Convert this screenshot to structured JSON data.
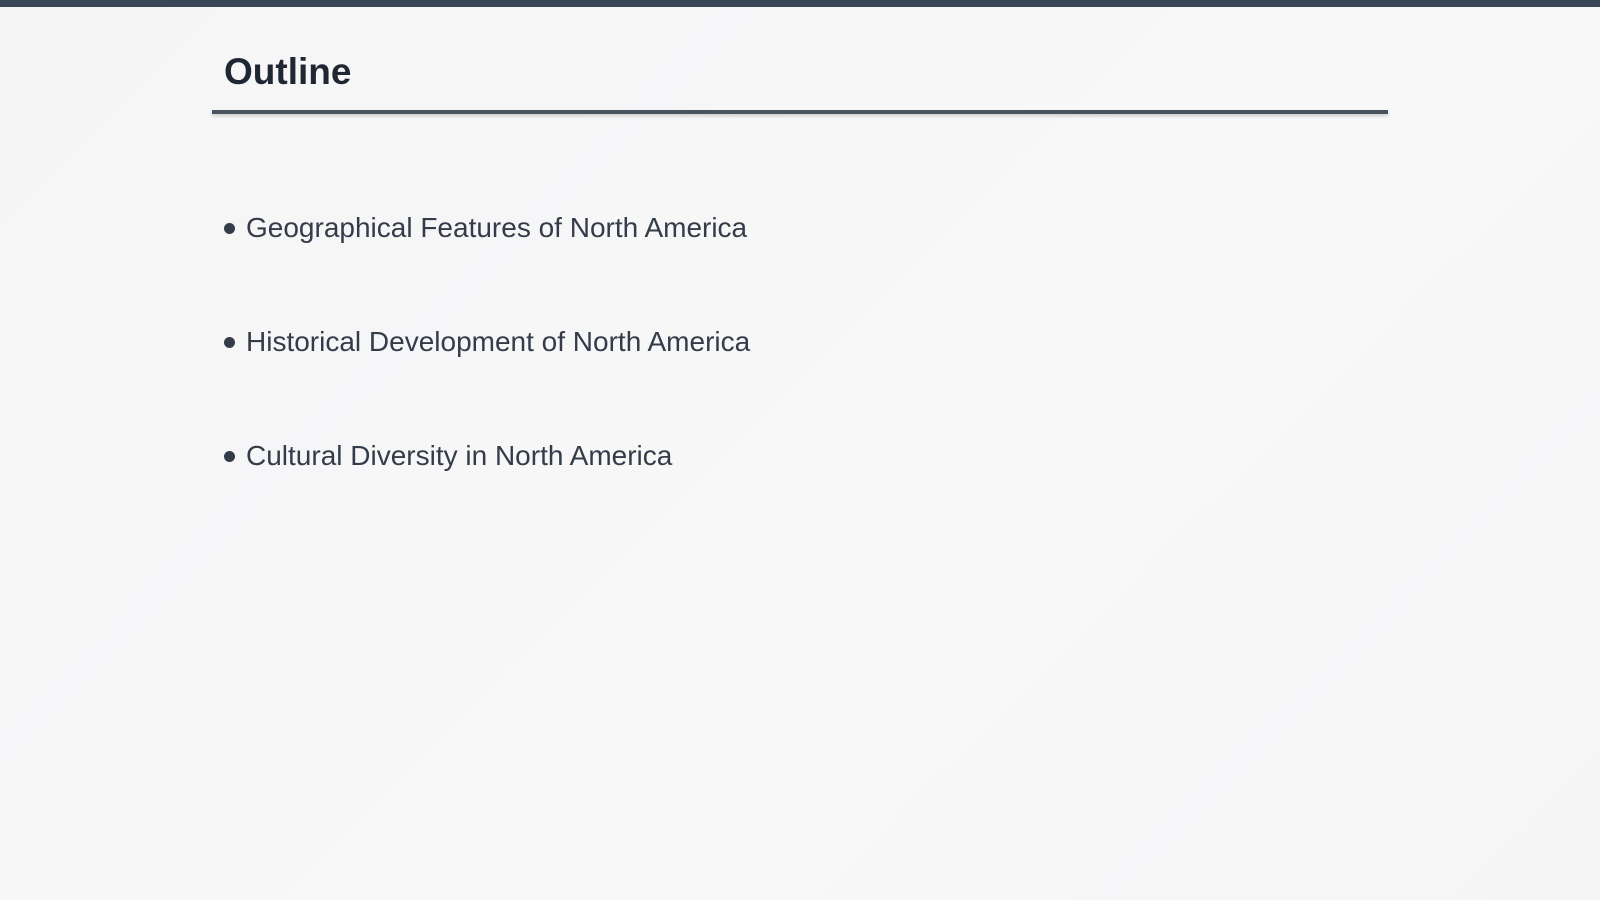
{
  "slide": {
    "title": "Outline",
    "bullets": [
      {
        "text": "Geographical Features of North America"
      },
      {
        "text": "Historical Development of North America"
      },
      {
        "text": "Cultural Diversity in North America"
      }
    ]
  },
  "colors": {
    "accent_bar": "#3b4756",
    "title_text": "#1f2733",
    "body_text": "#333c48",
    "background": "#f6f6f7"
  }
}
